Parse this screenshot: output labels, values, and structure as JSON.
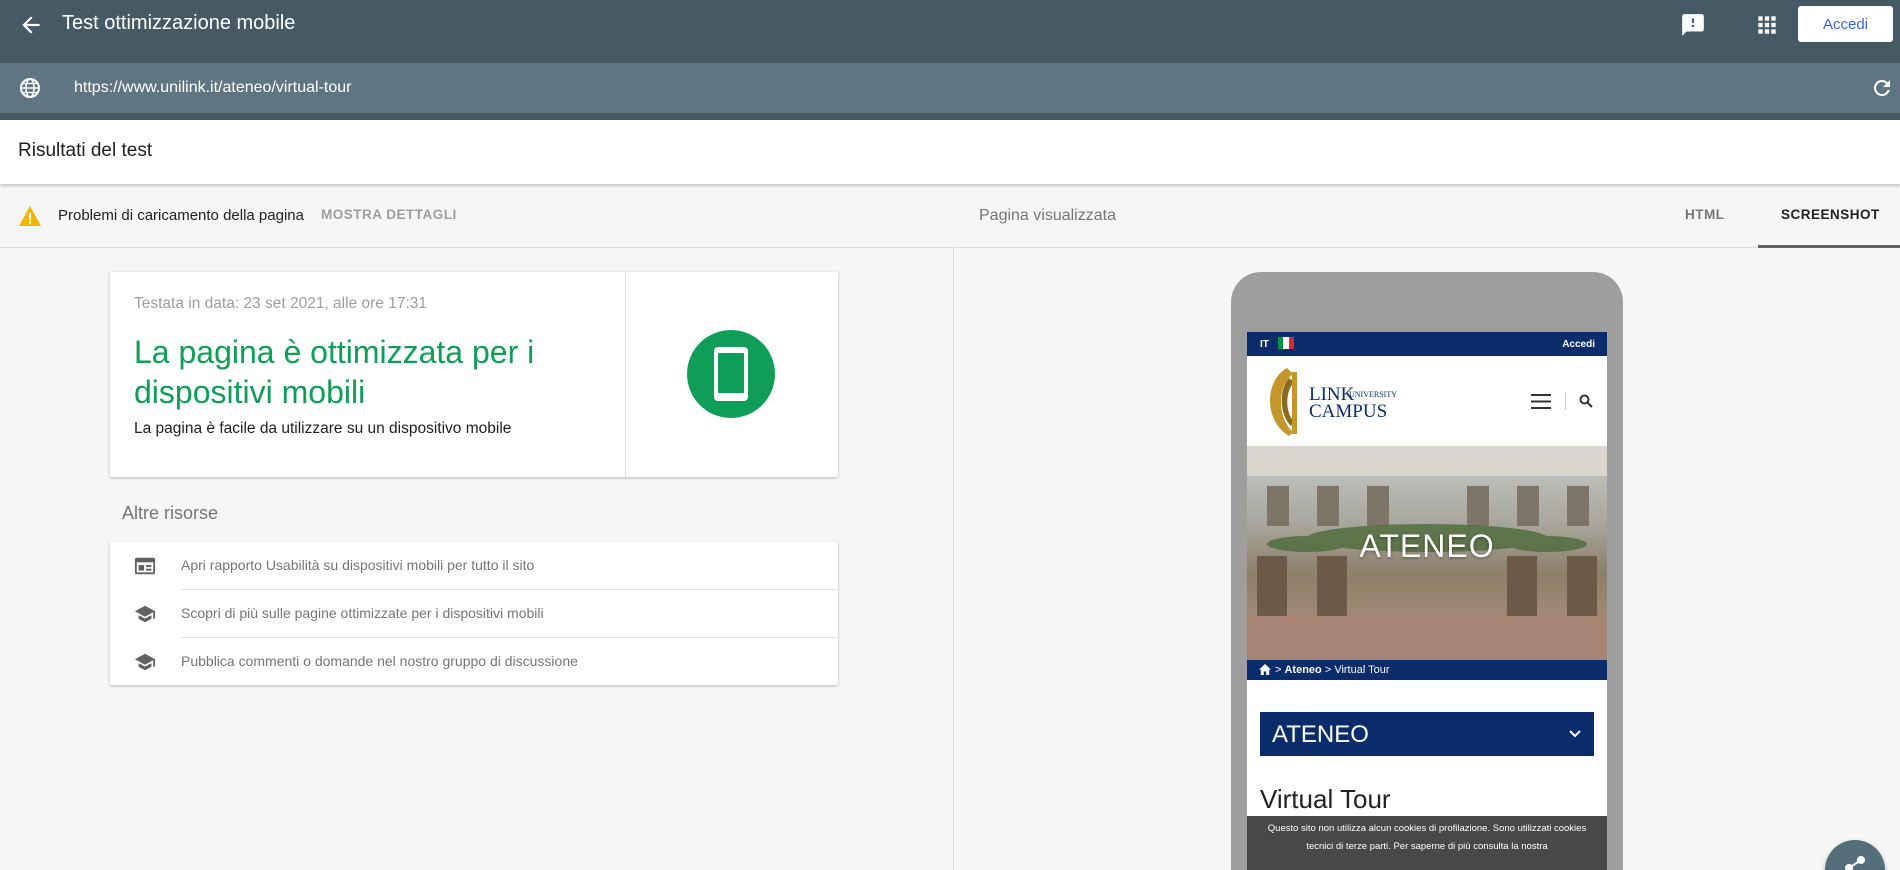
{
  "app": {
    "title": "Test ottimizzazione mobile",
    "signin_label": "Accedi",
    "url": "https://www.unilink.it/ateneo/virtual-tour",
    "icons": {
      "back": "arrow-back-icon",
      "feedback": "feedback-icon",
      "apps": "apps-grid-icon",
      "globe": "globe-icon",
      "reload": "reload-icon"
    }
  },
  "results": {
    "title": "Risultati del test",
    "issues_text": "Problemi di caricamento della pagina",
    "show_details": "MOSTRA DETTAGLI",
    "tested_date": "Testata in data: 23 set 2021, alle ore 17:31",
    "verdict": "La pagina è ottimizzata per i dispositivi mobili",
    "verdict_sub": "La pagina è facile da utilizzare su un dispositivo mobile",
    "verdict_color": "#0f9d58",
    "other_resources_title": "Altre risorse",
    "resources": [
      {
        "label": "Apri rapporto Usabilità su dispositivi mobili per tutto il sito",
        "icon": "report-icon"
      },
      {
        "label": "Scopri di più sulle pagine ottimizzate per i dispositivi mobili",
        "icon": "school-icon"
      },
      {
        "label": "Pubblica commenti o domande nel nostro gruppo di discussione",
        "icon": "school-icon"
      }
    ]
  },
  "preview": {
    "label": "Pagina visualizzata",
    "tabs": [
      {
        "label": "HTML",
        "active": false
      },
      {
        "label": "SCREENSHOT",
        "active": true
      }
    ],
    "mobile": {
      "lang": "IT",
      "login": "Accedi",
      "logo_university": "UNIVERSITY",
      "logo_link": "LINK",
      "logo_campus": "CAMPUS",
      "hero_title": "ATENEO",
      "breadcrumb_sep1": " > ",
      "breadcrumb_mid": "Ateneo",
      "breadcrumb_sep2": " > ",
      "breadcrumb_last": "Virtual Tour",
      "dropdown_label": "ATENEO",
      "heading": "Virtual Tour",
      "cookie_text": "Questo sito non utilizza alcun cookies di profilazione. Sono utilizzati cookies tecnici di terze parti. Per saperne di più consulta la nostra"
    }
  }
}
